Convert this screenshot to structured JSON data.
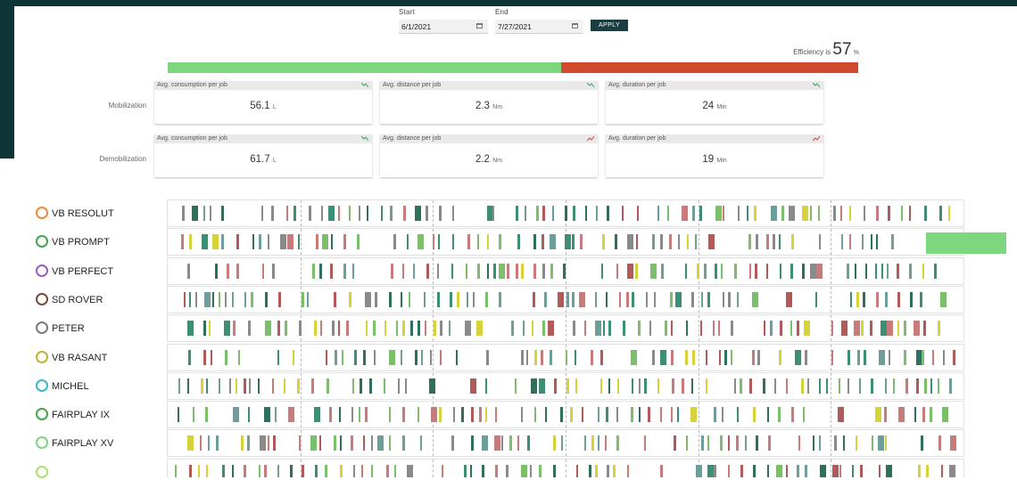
{
  "filters": {
    "start_label": "Start",
    "start_value": "6/1/2021",
    "end_label": "End",
    "end_value": "7/27/2021",
    "apply_label": "APPLY"
  },
  "efficiency": {
    "prefix": "Efficiency is",
    "value": "57",
    "suffix": "%",
    "fraction": 0.57,
    "good_color": "#7ed67e",
    "bad_color": "#d1492f"
  },
  "kpis": [
    {
      "row_label": "Mobilization",
      "cards": [
        {
          "title": "Avg. consumption per job",
          "value": "56.1",
          "unit": "L",
          "trend": "down"
        },
        {
          "title": "Avg. distance per job",
          "value": "2.3",
          "unit": "Nm",
          "trend": "down"
        },
        {
          "title": "Avg. duration per job",
          "value": "24",
          "unit": "Min",
          "trend": "down"
        }
      ]
    },
    {
      "row_label": "Demobilization",
      "cards": [
        {
          "title": "Avg. consumption per job",
          "value": "61.7",
          "unit": "L",
          "trend": "down"
        },
        {
          "title": "Avg. distance per job",
          "value": "2.2",
          "unit": "Nm",
          "trend": "up"
        },
        {
          "title": "Avg. duration per job",
          "value": "19",
          "unit": "Min",
          "trend": "up"
        }
      ]
    }
  ],
  "vessels": [
    {
      "name": "VB RESOLUT",
      "color": "#ef8a3c"
    },
    {
      "name": "VB PROMPT",
      "color": "#3fa844"
    },
    {
      "name": "VB PERFECT",
      "color": "#9b59c6"
    },
    {
      "name": "SD ROVER",
      "color": "#7a4a3d"
    },
    {
      "name": "PETER",
      "color": "#7a7a7a"
    },
    {
      "name": "VB RASANT",
      "color": "#bfb52e"
    },
    {
      "name": "MICHEL",
      "color": "#3bb6c9"
    },
    {
      "name": "FAIRPLAY IX",
      "color": "#3fa844"
    },
    {
      "name": "FAIRPLAY XV",
      "color": "#7ed67e"
    },
    {
      "name": "",
      "color": "#a9e36b"
    }
  ],
  "event_colors": [
    "#3e8e75",
    "#8a8a8a",
    "#c97b7b",
    "#7bbf6a",
    "#d6d23a",
    "#6d9e9a",
    "#b05a5a",
    "#2f6f5e"
  ],
  "timeline_highlight_color": "#7ed67e"
}
